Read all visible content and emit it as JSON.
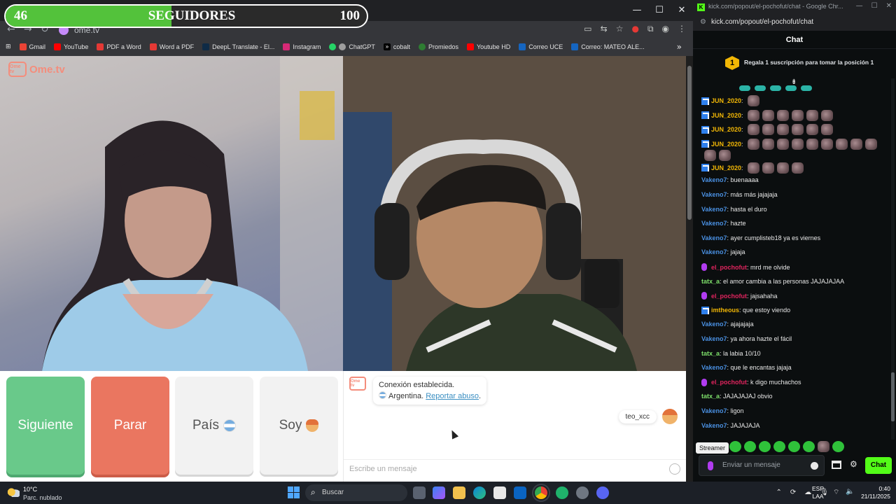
{
  "goal": {
    "current": "46",
    "title": "SEGUIDORES",
    "target": "100",
    "progress": 0.46
  },
  "browser_left": {
    "url": "ome.tv",
    "window_controls": [
      "—",
      "☐",
      "✕"
    ],
    "bookmarks": [
      "Gmail",
      "YouTube",
      "PDF a Word",
      "Word a PDF",
      "DeepL Translate - El...",
      "Instagram",
      "ChatGPT",
      "cobalt",
      "Promiedos",
      "Youtube HD",
      "Correo UCE",
      "Correo: MATEO ALE..."
    ],
    "bookmark_colors": [
      "#ea4335",
      "#ff0000",
      "#e53935",
      "#e53935",
      "#0f2b46",
      "#d62976",
      "#ffffff",
      "#000000",
      "#2e7d32",
      "#ff0000",
      "#1565c0",
      "#1565c0"
    ]
  },
  "ometv": {
    "logo_box": "Ome tv",
    "logo_text": "Ome.tv",
    "buttons": {
      "next": "Siguiente",
      "stop": "Parar",
      "country": "País",
      "i_am": "Soy"
    },
    "system_message": {
      "line1": "Conexión establecida.",
      "country": "Argentina.",
      "report_link": "Reportar abuso",
      "end": "."
    },
    "my_message": "teo_xcc",
    "input_placeholder": "Escribe un mensaje"
  },
  "kick": {
    "window_title": "kick.com/popout/el-pochofut/chat - Google Chr...",
    "url": "kick.com/popout/el-pochofut/chat",
    "chat_title": "Chat",
    "promo_rank": "1",
    "promo_text": "Regala 1 suscripción para tomar la posición 1",
    "messages": [
      {
        "user": "JUN_2020",
        "text": "",
        "color": "#f2b705",
        "badge": "sub",
        "emotes": 1
      },
      {
        "user": "JUN_2020",
        "text": "",
        "color": "#f2b705",
        "badge": "sub",
        "emotes": 6
      },
      {
        "user": "JUN_2020",
        "text": "",
        "color": "#f2b705",
        "badge": "sub",
        "emotes": 6
      },
      {
        "user": "JUN_2020",
        "text": "",
        "color": "#f2b705",
        "badge": "sub",
        "emotes": 11
      },
      {
        "user": "JUN_2020",
        "text": "",
        "color": "#f2b705",
        "badge": "sub",
        "emotes": 4
      },
      {
        "user": "Vakeno7",
        "text": "buenaaaa",
        "color": "#4a90e2",
        "badge": "",
        "emotes": 0
      },
      {
        "user": "Vakeno7",
        "text": "más más jajajaja",
        "color": "#4a90e2",
        "badge": "",
        "emotes": 0
      },
      {
        "user": "Vakeno7",
        "text": "hasta el duro",
        "color": "#4a90e2",
        "badge": "",
        "emotes": 0
      },
      {
        "user": "Vakeno7",
        "text": "hazte",
        "color": "#4a90e2",
        "badge": "",
        "emotes": 0
      },
      {
        "user": "Vakeno7",
        "text": "ayer cumplisteb18 ya es viernes",
        "color": "#4a90e2",
        "badge": "",
        "emotes": 0
      },
      {
        "user": "Vakeno7",
        "text": "jajaja",
        "color": "#4a90e2",
        "badge": "",
        "emotes": 0
      },
      {
        "user": "el_pochofut",
        "text": "mrd me olvide",
        "color": "#e0245e",
        "badge": "mic",
        "emotes": 0
      },
      {
        "user": "tatx_a",
        "text": "el amor cambia a las personas JAJAJAJAA",
        "color": "#7ee06b",
        "badge": "",
        "emotes": 0
      },
      {
        "user": "el_pochofut",
        "text": "jajsahaha",
        "color": "#e0245e",
        "badge": "mic",
        "emotes": 0
      },
      {
        "user": "imtheous",
        "text": "que estoy viendo",
        "color": "#f2b705",
        "badge": "sub",
        "emotes": 0
      },
      {
        "user": "Vakeno7",
        "text": "ajajajaja",
        "color": "#4a90e2",
        "badge": "",
        "emotes": 0
      },
      {
        "user": "Vakeno7",
        "text": "ya ahora hazte el fácil",
        "color": "#4a90e2",
        "badge": "",
        "emotes": 0
      },
      {
        "user": "tatx_a",
        "text": "la labia 10/10",
        "color": "#7ee06b",
        "badge": "",
        "emotes": 0
      },
      {
        "user": "Vakeno7",
        "text": "que le encantas jajaja",
        "color": "#4a90e2",
        "badge": "",
        "emotes": 0
      },
      {
        "user": "el_pochofut",
        "text": "k digo muchachos",
        "color": "#e0245e",
        "badge": "mic",
        "emotes": 0
      },
      {
        "user": "tatx_a",
        "text": "JAJAJAJAJ obvio",
        "color": "#7ee06b",
        "badge": "",
        "emotes": 0
      },
      {
        "user": "Vakeno7",
        "text": "ligon",
        "color": "#4a90e2",
        "badge": "",
        "emotes": 0
      },
      {
        "user": "Vakeno7",
        "text": "JAJAJAJA",
        "color": "#4a90e2",
        "badge": "",
        "emotes": 0
      }
    ],
    "tooltip": "Streamer",
    "input_placeholder": "Enviar un mensaje",
    "send_label": "Chat"
  },
  "taskbar": {
    "temp": "10°C",
    "condition": "Parc. nublado",
    "search_label": "Buscar",
    "lang_top": "ESP",
    "lang_bottom": "LAA",
    "time": "0:40",
    "date": "21/11/2025"
  }
}
